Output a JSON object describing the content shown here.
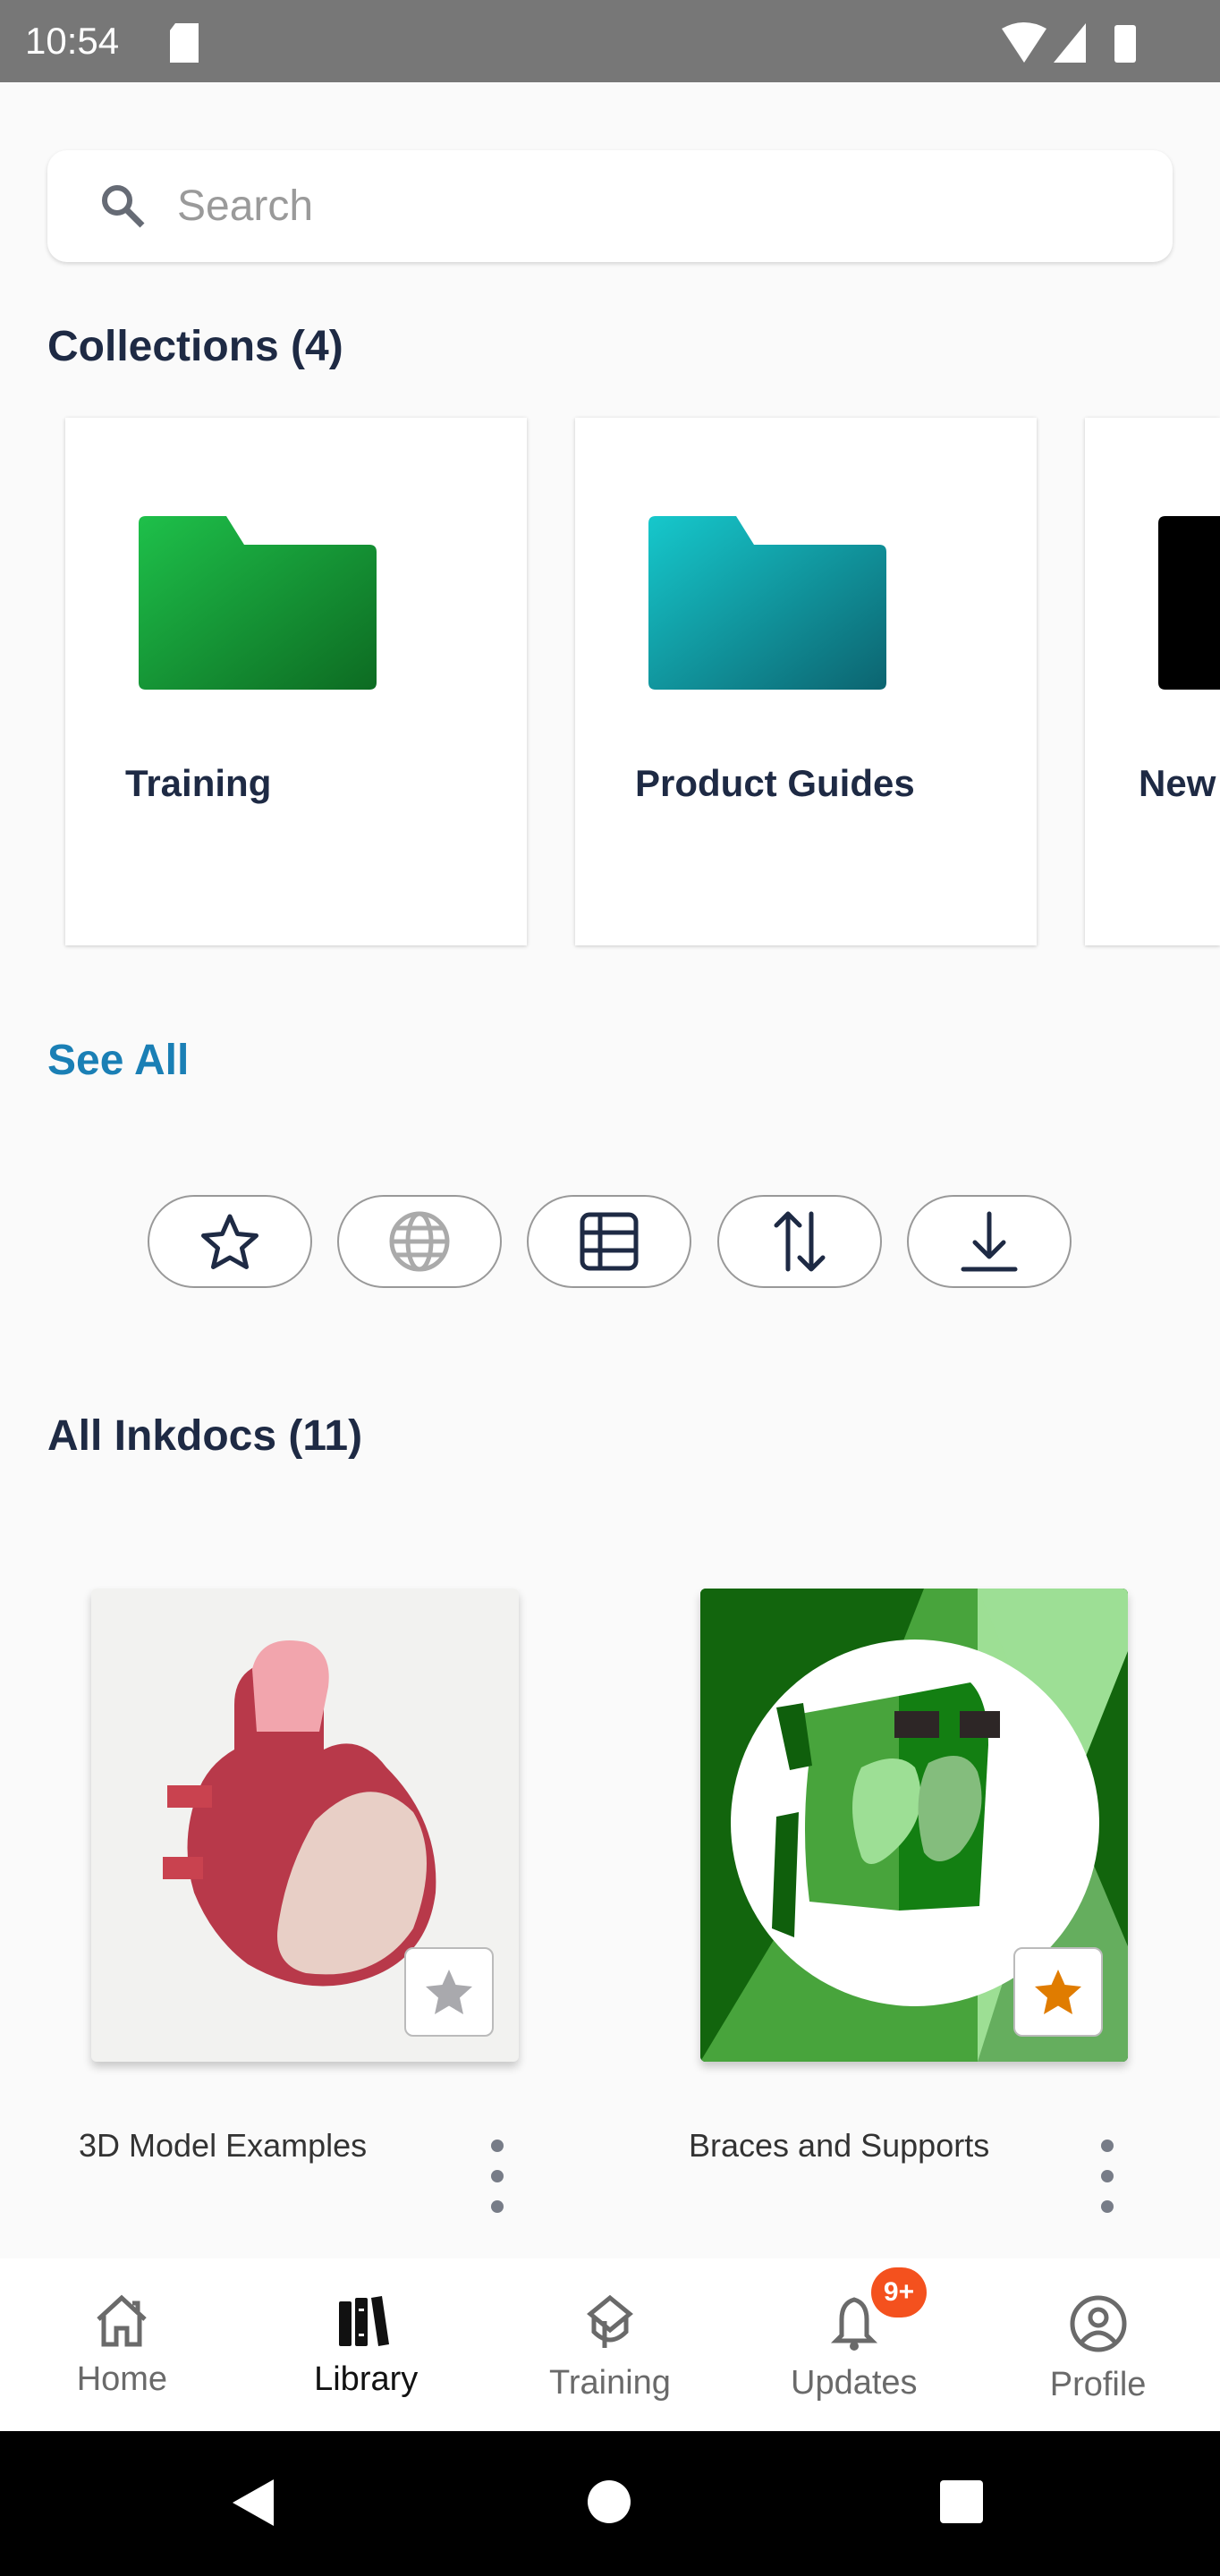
{
  "status": {
    "time": "10:54"
  },
  "search": {
    "placeholder": "Search"
  },
  "collections": {
    "title": "Collections (4)",
    "items": [
      {
        "label": "Training",
        "color": "#1db954"
      },
      {
        "label": "Product Guides",
        "color": "#17c1c8"
      },
      {
        "label": "New",
        "color": "#000000"
      }
    ],
    "see_all": "See All"
  },
  "filters": [
    {
      "icon": "star-icon"
    },
    {
      "icon": "globe-icon"
    },
    {
      "icon": "table-icon"
    },
    {
      "icon": "sort-icon"
    },
    {
      "icon": "download-icon"
    }
  ],
  "inkdocs": {
    "title": "All Inkdocs (11)",
    "items": [
      {
        "label": "3D Model Examples",
        "favorite": false
      },
      {
        "label": "Braces and Supports",
        "favorite": true
      }
    ]
  },
  "nav": {
    "items": [
      {
        "label": "Home"
      },
      {
        "label": "Library",
        "active": true
      },
      {
        "label": "Training"
      },
      {
        "label": "Updates",
        "badge": "9+"
      },
      {
        "label": "Profile"
      }
    ]
  },
  "colors": {
    "accent": "#1a7fb5",
    "badge": "#f4511e",
    "favorite": "#e07c00"
  }
}
